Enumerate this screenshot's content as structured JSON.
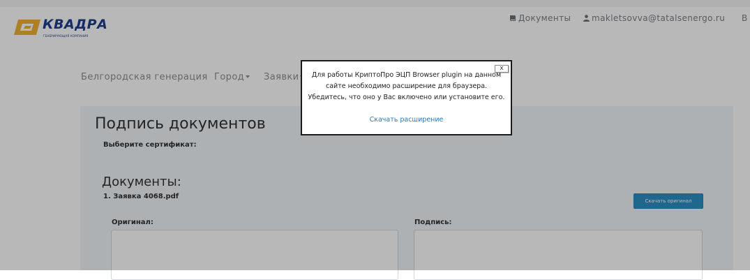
{
  "brand": {
    "name": "КВАДРА",
    "tagline": "ГЕНЕРИРУЮЩАЯ КОМПАНИЯ",
    "colors": {
      "primary": "#1e3f8c",
      "accent": "#f2b233"
    }
  },
  "top_nav": {
    "documents_icon": "book-icon",
    "documents": "Документы",
    "user_icon": "user-icon",
    "user": "makletsovva@tatalsenergo.ru",
    "overflow": "В"
  },
  "main_nav": {
    "items": [
      {
        "label": "Белгородская генерация",
        "dropdown": false
      },
      {
        "label": "Город",
        "dropdown": true
      },
      {
        "label": "Заявки",
        "dropdown": true
      }
    ]
  },
  "page": {
    "title": "Подпись документов",
    "select_certificate": "Выберите сертификат:",
    "documents_title": "Документы:",
    "document_item": "1. Заявка 4068.pdf",
    "download_button": "Скачать оригинал",
    "original_label": "Оригинал:",
    "signature_label": "Подпись:",
    "accent_color": "#2c8fc4"
  },
  "modal": {
    "close_label": "x",
    "message": "Для работы КриптоПро ЭЦП Browser plugin на данном сайте необходимо расширение для браузера. Убедитесь, что оно у Вас включено или установите его.",
    "link": "Скачать расширение"
  }
}
